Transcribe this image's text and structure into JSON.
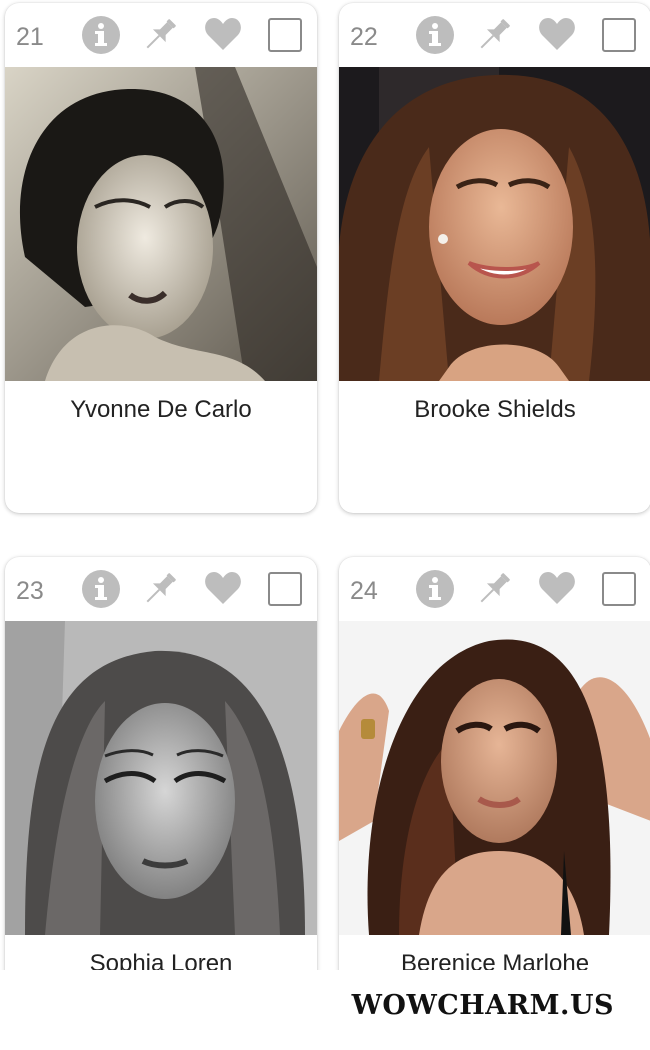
{
  "cards": [
    {
      "rank": "21",
      "name": "Yvonne De Carlo"
    },
    {
      "rank": "22",
      "name": "Brooke Shields"
    },
    {
      "rank": "23",
      "name": "Sophia Loren"
    },
    {
      "rank": "24",
      "name": "Berenice Marlohe"
    }
  ],
  "icons": [
    "info-icon",
    "pin-icon",
    "heart-icon",
    "checkbox"
  ],
  "colors": {
    "icon_gray": "#bdbdbd",
    "rank_gray": "#8a8a8a",
    "text": "#222222"
  },
  "watermark": "WOWCHARM.US"
}
